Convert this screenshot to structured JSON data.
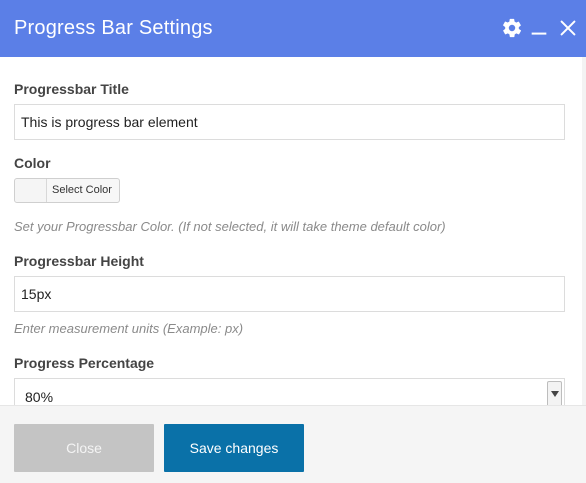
{
  "dialog": {
    "title": "Progress Bar Settings",
    "icons": [
      "gear-icon",
      "minimize-icon",
      "close-icon"
    ],
    "header_color": "#5b7fe7"
  },
  "fields": {
    "title": {
      "label": "Progressbar Title",
      "value": "This is progress bar element"
    },
    "color": {
      "label": "Color",
      "button_label": "Select Color",
      "hint": "Set your Progressbar Color. (If not selected, it will take theme default color)"
    },
    "height": {
      "label": "Progressbar Height",
      "value": "15px",
      "hint": "Enter measurement units (Example: px)"
    },
    "percentage": {
      "label": "Progress Percentage",
      "selected": "80%"
    }
  },
  "footer": {
    "close_label": "Close",
    "save_label": "Save changes",
    "save_color": "#0a71a8"
  }
}
